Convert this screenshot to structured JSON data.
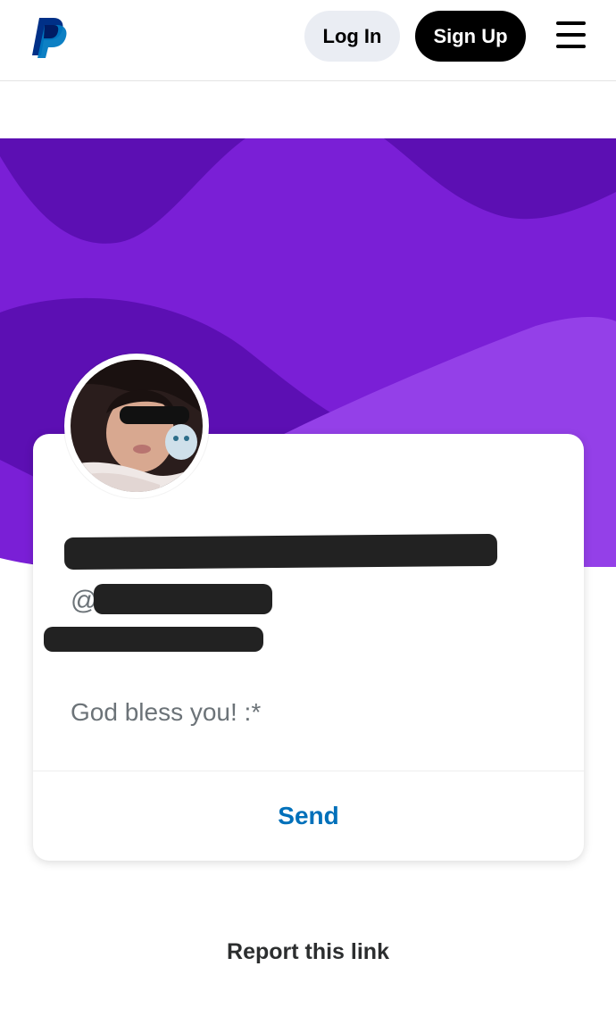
{
  "header": {
    "logo_icon": "paypal-logo",
    "login_label": "Log In",
    "signup_label": "Sign Up",
    "menu_icon": "hamburger-menu-icon"
  },
  "colors": {
    "hero_dark": "#5c0fb3",
    "hero_main": "#7a1fd6",
    "hero_light": "#9440e8",
    "link_blue": "#0070ba",
    "login_bg": "#eaedf3",
    "signup_bg": "#000000"
  },
  "profile": {
    "handle_prefix": "@",
    "note": "God bless you! :*",
    "send_label": "Send"
  },
  "footer": {
    "report_label": "Report this link"
  }
}
